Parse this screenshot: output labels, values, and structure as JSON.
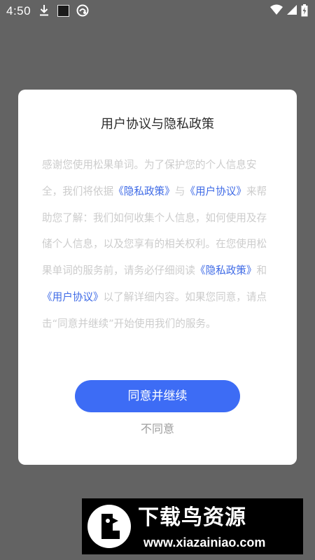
{
  "status_bar": {
    "time": "4:50",
    "icons": [
      "download-icon",
      "square-notification-icon",
      "app-notification-icon",
      "wifi-icon",
      "signal-icon",
      "battery-charging-icon"
    ]
  },
  "dialog": {
    "title": "用户协议与隐私政策",
    "body": [
      {
        "text": "感谢您使用松果单词。为了保护您的个人信息安全，我们将依据",
        "link": false
      },
      {
        "text": "《隐私政策》",
        "link": true
      },
      {
        "text": "与",
        "link": false
      },
      {
        "text": "《用户协议》",
        "link": true
      },
      {
        "text": "来帮助您了解：我们如何收集个人信息，如何使用及存储个人信息，以及您享有的相关权利。在您使用松果单词的服务前，请务必仔细阅读",
        "link": false
      },
      {
        "text": "《隐私政策》",
        "link": true
      },
      {
        "text": "和",
        "link": false
      },
      {
        "text": "《用户协议》",
        "link": true
      },
      {
        "text": "以了解详细内容。如果您同意，请点击“同意并继续”开始使用我们的服务。",
        "link": false
      }
    ],
    "agree_label": "同意并继续",
    "disagree_label": "不同意"
  },
  "watermark": {
    "title": "下载鸟资源",
    "url": "www.xiazainiao.com"
  },
  "colors": {
    "backdrop": "#636363",
    "accent": "#3d6cf5",
    "link": "#3e6ae6",
    "body_text": "#cccccc"
  }
}
